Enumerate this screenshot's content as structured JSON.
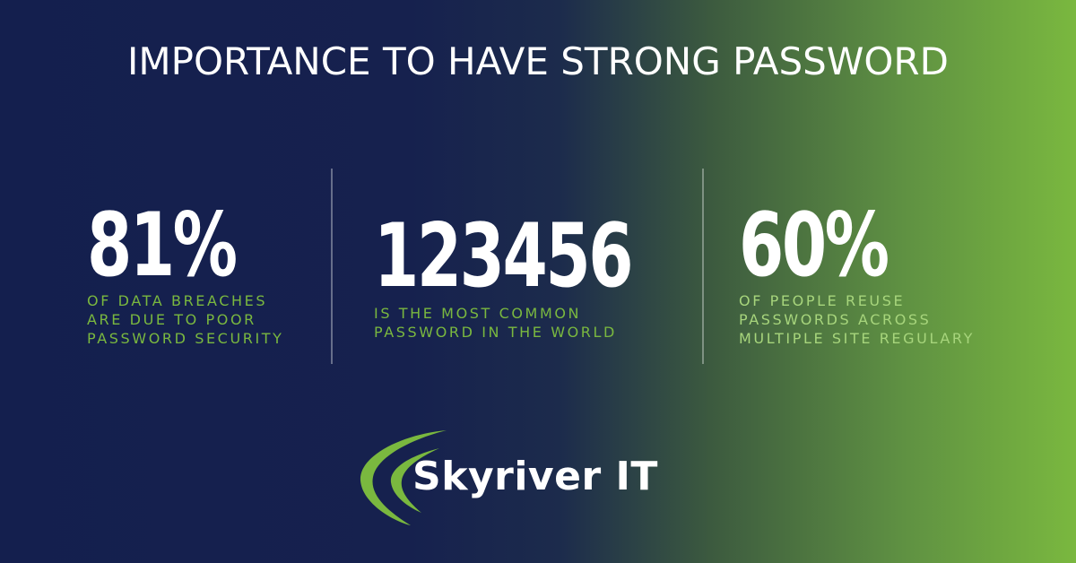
{
  "title": "IMPORTANCE TO HAVE STRONG PASSWORD",
  "colors": {
    "navy": "#141f4e",
    "green": "#7ab83f",
    "light_green": "#a7d57c",
    "white": "#ffffff"
  },
  "stats": [
    {
      "value": "81%",
      "lines": [
        "OF DATA BREACHES",
        "ARE DUE TO POOR",
        "PASSWORD SECURITY"
      ]
    },
    {
      "value": "123456",
      "lines": [
        "IS THE MOST COMMON",
        "PASSWORD IN THE WORLD"
      ]
    },
    {
      "value": "60%",
      "lines": [
        "OF PEOPLE REUSE",
        "PASSWORDS ACROSS",
        "MULTIPLE SITE REGULARY"
      ]
    }
  ],
  "logo": {
    "text": "Skyriver IT",
    "icon": "swoosh-icon"
  }
}
